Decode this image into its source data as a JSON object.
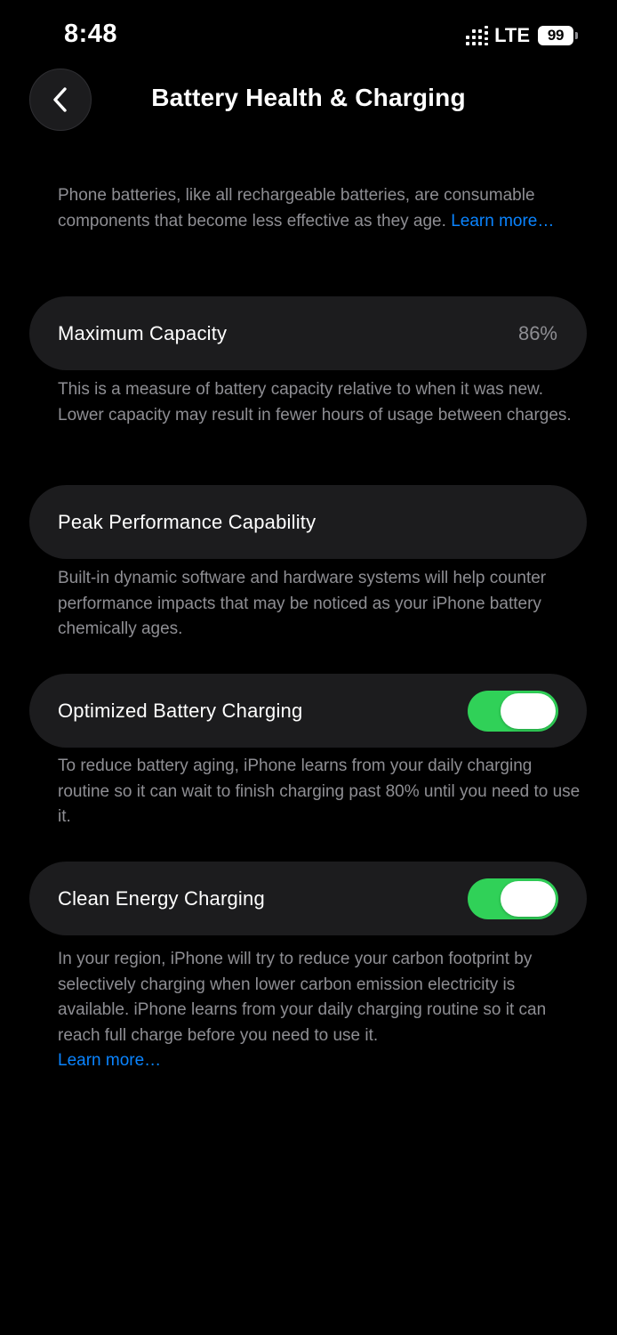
{
  "status_bar": {
    "time": "8:48",
    "network": "LTE",
    "battery_level": "99",
    "signal_icon": "signal-bars-icon",
    "battery_icon": "battery-icon"
  },
  "nav": {
    "title": "Battery Health & Charging",
    "back_icon": "chevron-left-icon"
  },
  "intro": {
    "text": "Phone batteries, like all rechargeable batteries, are consumable components that become less effective as they age.",
    "link": "Learn more…"
  },
  "maximum_capacity": {
    "label": "Maximum Capacity",
    "value": "86%",
    "description": "This is a measure of battery capacity relative to when it was new. Lower capacity may result in fewer hours of usage between charges."
  },
  "peak_performance": {
    "label": "Peak Performance Capability",
    "description": "Built-in dynamic software and hardware systems will help counter performance impacts that may be noticed as your iPhone battery chemically ages."
  },
  "optimized_charging": {
    "label": "Optimized Battery Charging",
    "enabled": true,
    "description": "To reduce battery aging, iPhone learns from your daily charging routine so it can wait to finish charging past 80% until you need to use it."
  },
  "clean_energy": {
    "label": "Clean Energy Charging",
    "enabled": true,
    "description": "In your region, iPhone will try to reduce your carbon footprint by selectively charging when lower carbon emission electricity is available. iPhone learns from your daily charging routine so it can reach full charge before you need to use it.",
    "link": "Learn more…"
  },
  "colors": {
    "background": "#000000",
    "card": "#1c1c1e",
    "secondary_text": "#8e8e93",
    "link": "#0a84ff",
    "toggle_on": "#30d158"
  }
}
